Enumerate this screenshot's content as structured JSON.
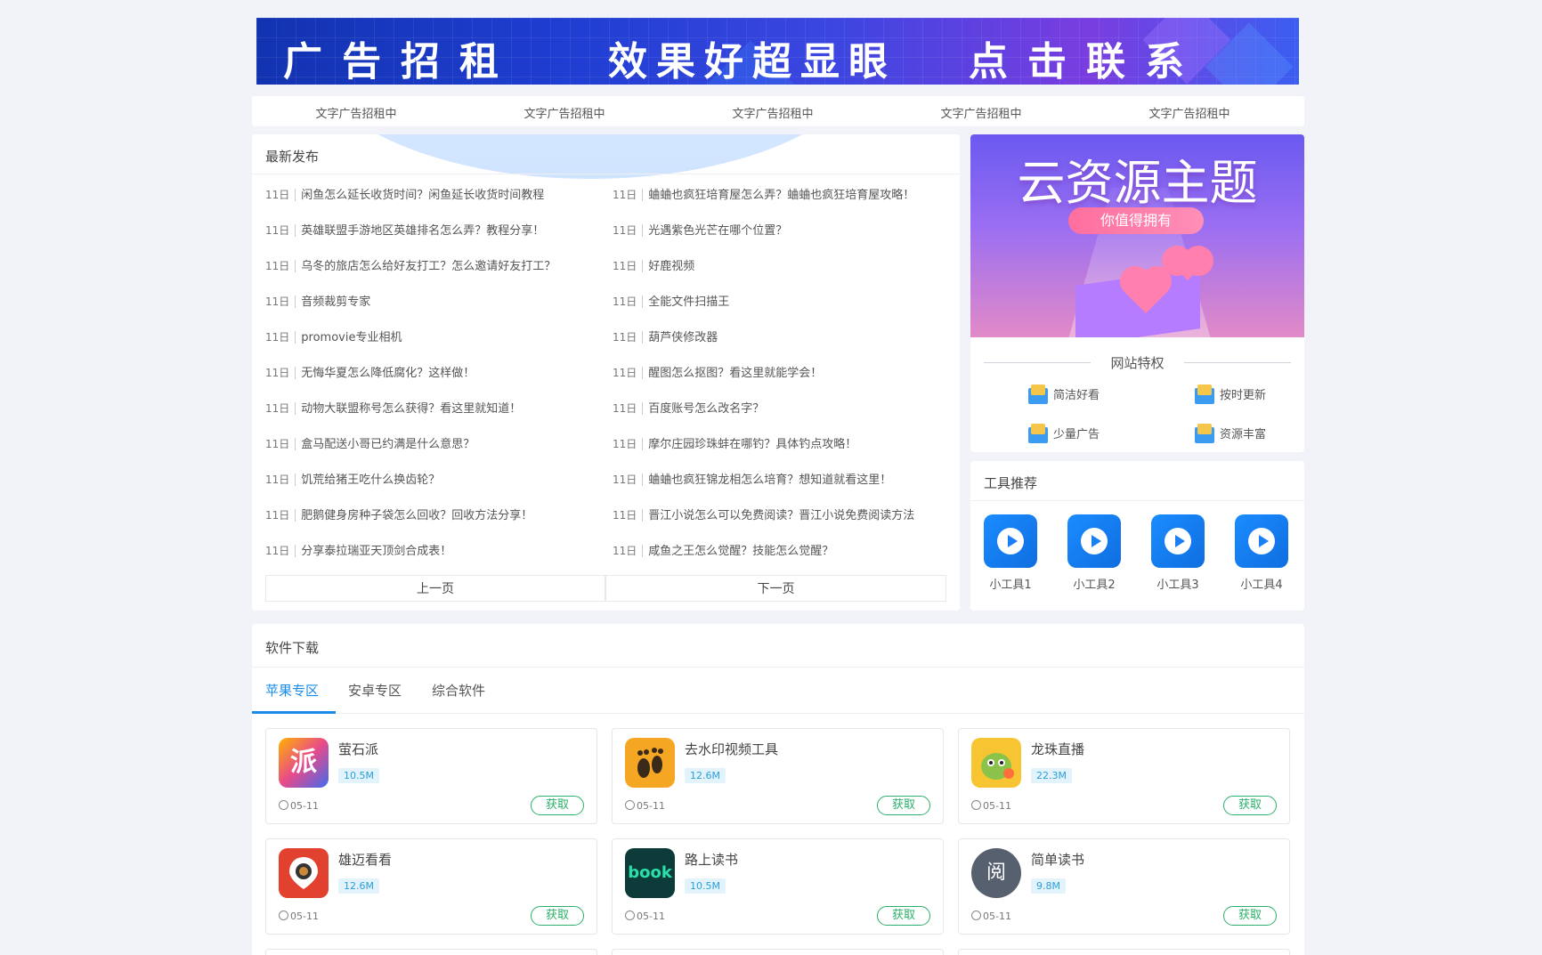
{
  "banner": {
    "left_text": "广告招租",
    "mid_text": "效果好超显眼",
    "right_text": "点击联系"
  },
  "text_ads": [
    "文字广告招租中",
    "文字广告招租中",
    "文字广告招租中",
    "文字广告招租中",
    "文字广告招租中"
  ],
  "latest": {
    "title": "最新发布",
    "items": [
      {
        "date": "11日",
        "title": "闲鱼怎么延长收货时间？闲鱼延长收货时间教程"
      },
      {
        "date": "11日",
        "title": "蛐蛐也疯狂培育屋怎么弄？蛐蛐也疯狂培育屋攻略！"
      },
      {
        "date": "11日",
        "title": "英雄联盟手游地区英雄排名怎么弄？教程分享！"
      },
      {
        "date": "11日",
        "title": "光遇紫色光芒在哪个位置？"
      },
      {
        "date": "11日",
        "title": "乌冬的旅店怎么给好友打工？怎么邀请好友打工？"
      },
      {
        "date": "11日",
        "title": "好鹿视频"
      },
      {
        "date": "11日",
        "title": "音频裁剪专家"
      },
      {
        "date": "11日",
        "title": "全能文件扫描王"
      },
      {
        "date": "11日",
        "title": "promovie专业相机"
      },
      {
        "date": "11日",
        "title": "葫芦侠修改器"
      },
      {
        "date": "11日",
        "title": "无悔华夏怎么降低腐化？这样做！"
      },
      {
        "date": "11日",
        "title": "醒图怎么抠图？看这里就能学会！"
      },
      {
        "date": "11日",
        "title": "动物大联盟称号怎么获得？看这里就知道！"
      },
      {
        "date": "11日",
        "title": "百度账号怎么改名字？"
      },
      {
        "date": "11日",
        "title": "盒马配送小哥已约满是什么意思？"
      },
      {
        "date": "11日",
        "title": "摩尔庄园珍珠蚌在哪钓？具体钓点攻略！"
      },
      {
        "date": "11日",
        "title": "饥荒给猪王吃什么换齿轮？"
      },
      {
        "date": "11日",
        "title": "蛐蛐也疯狂锦龙相怎么培育？想知道就看这里！"
      },
      {
        "date": "11日",
        "title": "肥鹅健身房种子袋怎么回收？回收方法分享！"
      },
      {
        "date": "11日",
        "title": "晋江小说怎么可以免费阅读？晋江小说免费阅读方法"
      },
      {
        "date": "11日",
        "title": "分享泰拉瑞亚天顶剑合成表！"
      },
      {
        "date": "11日",
        "title": "咸鱼之王怎么觉醒？技能怎么觉醒？"
      }
    ],
    "prev_label": "上一页",
    "next_label": "下一页"
  },
  "promo": {
    "title": "云资源主题",
    "pill": "你值得拥有",
    "section_title": "网站特权",
    "privileges": [
      "简洁好看",
      "按时更新",
      "少量广告",
      "资源丰富"
    ]
  },
  "tools": {
    "title": "工具推荐",
    "items": [
      "小工具1",
      "小工具2",
      "小工具3",
      "小工具4"
    ]
  },
  "downloads": {
    "title": "软件下载",
    "tabs": [
      "苹果专区",
      "安卓专区",
      "综合软件"
    ],
    "get_label": "获取",
    "apps": [
      {
        "name": "萤石派",
        "size": "10.5M",
        "date": "05-11",
        "logo_text": "派",
        "color": "#e84a8a"
      },
      {
        "name": "去水印视频工具",
        "size": "12.6M",
        "date": "05-11",
        "logo_text": "",
        "color": "#f5a623"
      },
      {
        "name": "龙珠直播",
        "size": "22.3M",
        "date": "05-11",
        "logo_text": "",
        "color": "#f7c531"
      },
      {
        "name": "雄迈看看",
        "size": "12.6M",
        "date": "05-11",
        "logo_text": "",
        "color": "#e2412f"
      },
      {
        "name": "路上读书",
        "size": "10.5M",
        "date": "05-11",
        "logo_text": "book",
        "color": "#0d3b3a"
      },
      {
        "name": "简单读书",
        "size": "9.8M",
        "date": "05-11",
        "logo_text": "阅",
        "color": "#56606e"
      }
    ]
  }
}
